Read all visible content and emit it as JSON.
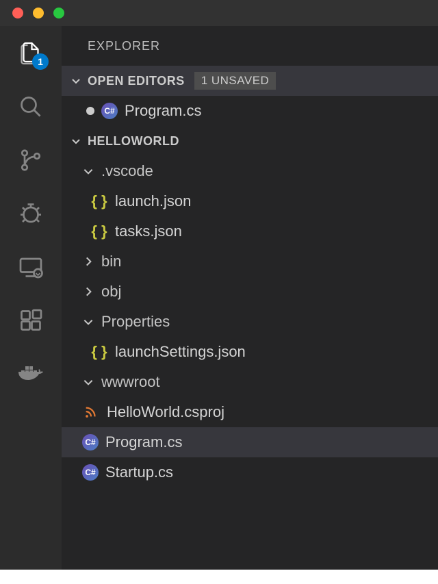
{
  "titlebar": {},
  "activityBar": {
    "badgeCount": "1"
  },
  "sidebar": {
    "title": "EXPLORER",
    "openEditors": {
      "label": "OPEN EDITORS",
      "unsavedLabel": "1 UNSAVED",
      "items": [
        {
          "name": "Program.cs",
          "modified": true,
          "iconType": "csharp"
        }
      ]
    },
    "workspace": {
      "name": "HELLOWORLD",
      "tree": [
        {
          "name": ".vscode",
          "type": "folder",
          "expanded": true,
          "indent": 1
        },
        {
          "name": "launch.json",
          "type": "json",
          "indent": 2
        },
        {
          "name": "tasks.json",
          "type": "json",
          "indent": 2
        },
        {
          "name": "bin",
          "type": "folder",
          "expanded": false,
          "indent": 1
        },
        {
          "name": "obj",
          "type": "folder",
          "expanded": false,
          "indent": 1
        },
        {
          "name": "Properties",
          "type": "folder",
          "expanded": true,
          "indent": 1
        },
        {
          "name": "launchSettings.json",
          "type": "json",
          "indent": 2
        },
        {
          "name": "wwwroot",
          "type": "folder",
          "expanded": true,
          "indent": 1
        },
        {
          "name": "HelloWorld.csproj",
          "type": "csproj",
          "indent": 1
        },
        {
          "name": "Program.cs",
          "type": "csharp",
          "indent": 1,
          "selected": true
        },
        {
          "name": "Startup.cs",
          "type": "csharp",
          "indent": 1
        }
      ]
    }
  }
}
